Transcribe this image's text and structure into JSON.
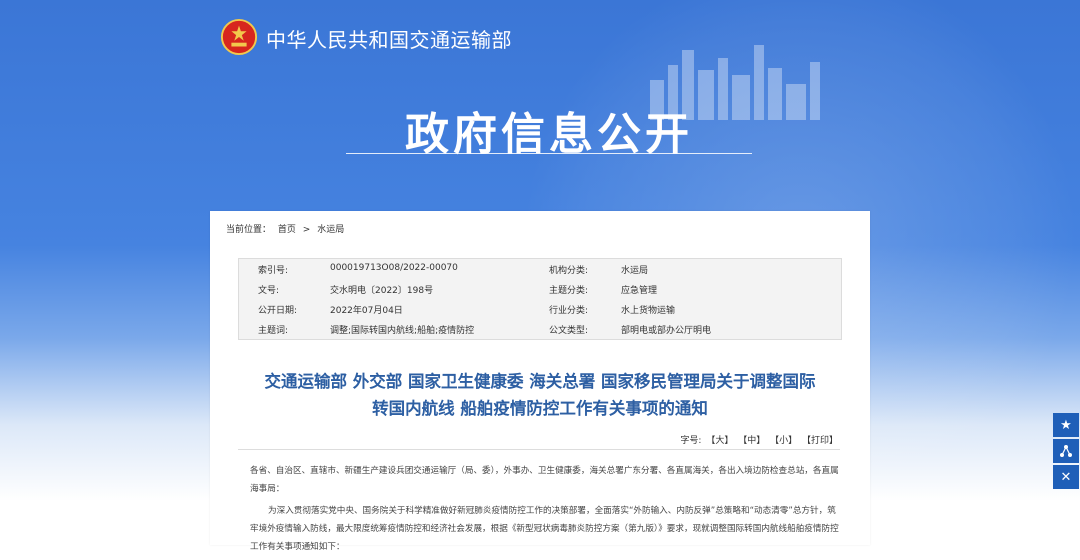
{
  "header": {
    "site_name": "中华人民共和国交通运输部",
    "banner_title": "政府信息公开"
  },
  "breadcrumb": {
    "label": "当前位置：",
    "items": [
      "首页",
      "水运局"
    ],
    "separator": ">"
  },
  "meta": [
    {
      "k1": "索引号:",
      "v1": "000019713O08/2022-00070",
      "k2": "机构分类:",
      "v2": "水运局"
    },
    {
      "k1": "文号:",
      "v1": "交水明电〔2022〕198号",
      "k2": "主题分类:",
      "v2": "应急管理"
    },
    {
      "k1": "公开日期:",
      "v1": "2022年07月04日",
      "k2": "行业分类:",
      "v2": "水上货物运输"
    },
    {
      "k1": "主题词:",
      "v1": "调整;国际转国内航线;船舶;疫情防控",
      "k2": "公文类型:",
      "v2": "部明电或部办公厅明电"
    }
  ],
  "doc": {
    "title_line1": "交通运输部 外交部 国家卫生健康委 海关总署 国家移民管理局关于调整国际",
    "title_line2": "转国内航线 船舶疫情防控工作有关事项的通知",
    "font_label": "字号:",
    "font_large": "【大】",
    "font_medium": "【中】",
    "font_small": "【小】",
    "print": "【打印】",
    "para1": "各省、自治区、直辖市、新疆生产建设兵团交通运输厅（局、委），外事办、卫生健康委，海关总署广东分署、各直属海关，各出入境边防检查总站，各直属海事局：",
    "para2": "为深入贯彻落实党中央、国务院关于科学精准做好新冠肺炎疫情防控工作的决策部署，全面落实“外防输入、内防反弹”总策略和“动态清零”总方针，筑牢境外疫情输入防线，最大限度统筹疫情防控和经济社会发展，根据《新型冠状病毒肺炎防控方案（第九版）》要求，现就调整国际转国内航线船舶疫情防控工作有关事项通知如下："
  },
  "side_tools": {
    "favorite_icon": "star-icon",
    "share_icon": "share-icon",
    "close_icon": "close-icon"
  }
}
